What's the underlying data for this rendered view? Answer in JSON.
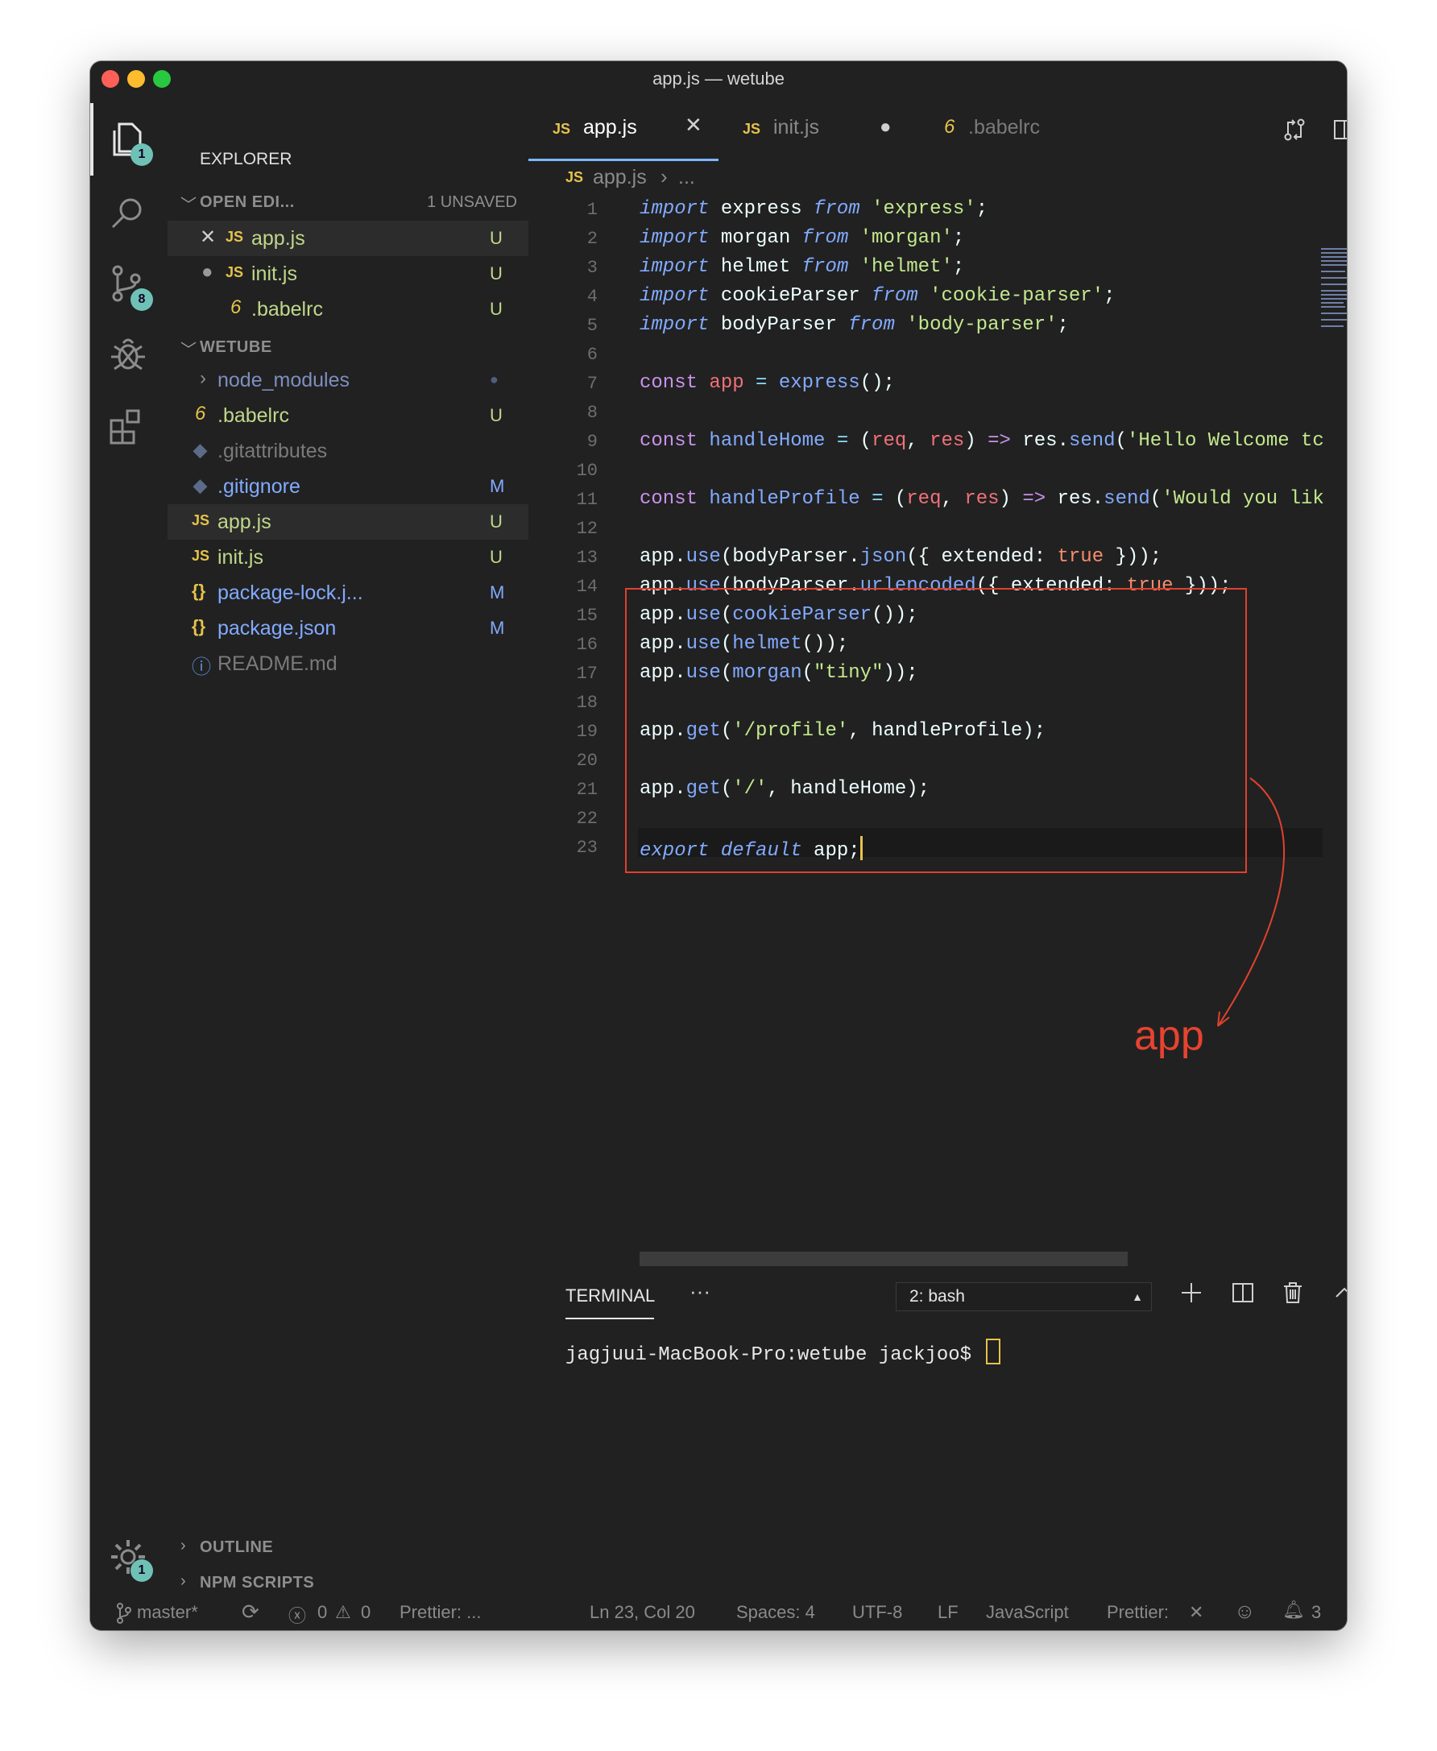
{
  "window": {
    "title": "app.js — wetube"
  },
  "activity": {
    "explorer_badge": "1",
    "source_control_badge": "8",
    "settings_badge": "1"
  },
  "sidebar": {
    "title": "EXPLORER",
    "open_editors": {
      "label": "OPEN EDI...",
      "unsaved": "1 UNSAVED",
      "items": [
        {
          "name": "app.js",
          "status": "U",
          "icon": "JS"
        },
        {
          "name": "init.js",
          "status": "U",
          "icon": "JS"
        },
        {
          "name": ".babelrc",
          "status": "U",
          "icon": "6"
        }
      ]
    },
    "project": {
      "label": "WETUBE",
      "items": [
        {
          "name": "node_modules",
          "status": ""
        },
        {
          "name": ".babelrc",
          "status": "U",
          "icon": "6"
        },
        {
          "name": ".gitattributes",
          "status": "",
          "icon": "◆"
        },
        {
          "name": ".gitignore",
          "status": "M",
          "icon": "◆"
        },
        {
          "name": "app.js",
          "status": "U",
          "icon": "JS"
        },
        {
          "name": "init.js",
          "status": "U",
          "icon": "JS"
        },
        {
          "name": "package-lock.j...",
          "status": "M",
          "icon": "{}"
        },
        {
          "name": "package.json",
          "status": "M",
          "icon": "{}"
        },
        {
          "name": "README.md",
          "status": "",
          "icon": "ⓘ"
        }
      ]
    },
    "outline_label": "OUTLINE",
    "npm_label": "NPM SCRIPTS"
  },
  "tabs": [
    {
      "icon": "JS",
      "label": "app.js"
    },
    {
      "icon": "JS",
      "label": "init.js"
    },
    {
      "icon": "6",
      "label": ".babelrc"
    }
  ],
  "breadcrumb": {
    "icon": "JS",
    "file": "app.js",
    "rest": "..."
  },
  "editor": {
    "line_numbers": [
      "1",
      "2",
      "3",
      "4",
      "5",
      "6",
      "7",
      "8",
      "9",
      "10",
      "11",
      "12",
      "13",
      "14",
      "15",
      "16",
      "17",
      "18",
      "19",
      "20",
      "21",
      "22",
      "23"
    ],
    "annotation": "app"
  },
  "terminal": {
    "tab": "TERMINAL",
    "more": "···",
    "shell_select": "2: bash",
    "prompt": "jagjuui-MacBook-Pro:wetube jackjoo$ "
  },
  "statusbar": {
    "branch": "master*",
    "errors": "0",
    "warnings": "0",
    "prettier_left": "Prettier: ...",
    "position": "Ln 23, Col 20",
    "spaces": "Spaces: 4",
    "encoding": "UTF-8",
    "eol": "LF",
    "language": "JavaScript",
    "prettier_right": "Prettier:",
    "bell_count": "3"
  },
  "colors": {
    "accent_yellow": "#e5c34b",
    "annotation_red": "#e0412f",
    "badge_teal": "#6fc1b6"
  }
}
